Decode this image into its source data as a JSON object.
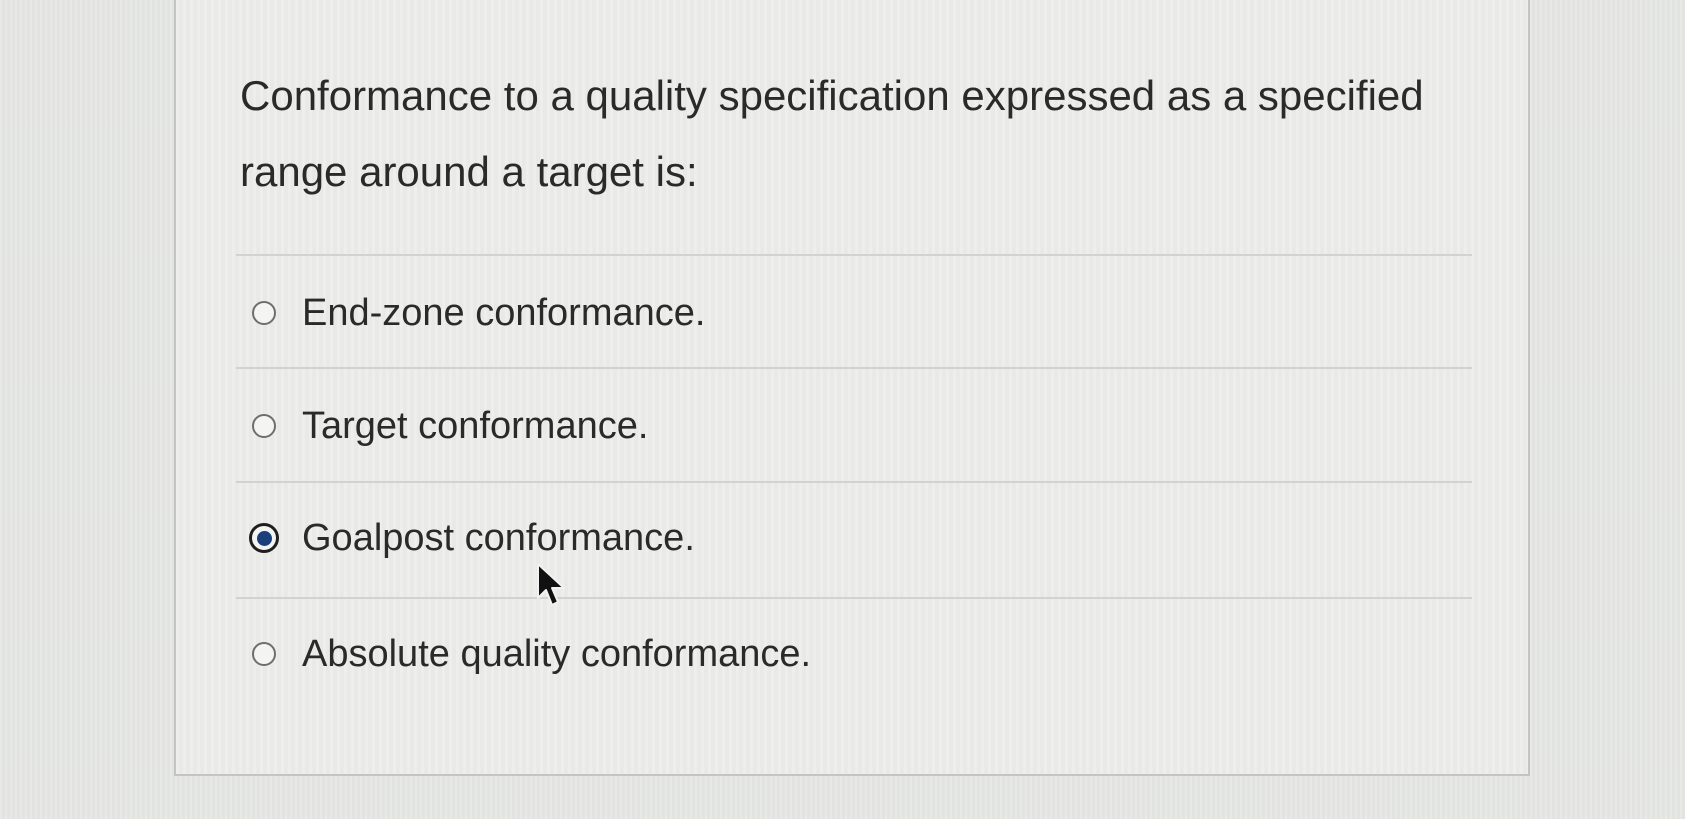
{
  "question": {
    "text": "Conformance to a quality specification expressed as a specified range around a target is:"
  },
  "options": [
    {
      "label": "End-zone conformance.",
      "selected": false
    },
    {
      "label": "Target conformance.",
      "selected": false
    },
    {
      "label": "Goalpost conformance.",
      "selected": true
    },
    {
      "label": "Absolute quality conformance.",
      "selected": false
    }
  ],
  "colors": {
    "background": "#e6e7e4",
    "card": "#ecedea",
    "text": "#2a2a2a",
    "radio_selected_fill": "#1b3f7a",
    "divider": "#d2d3d0"
  },
  "icons": {
    "cursor": "mouse-pointer-icon"
  }
}
